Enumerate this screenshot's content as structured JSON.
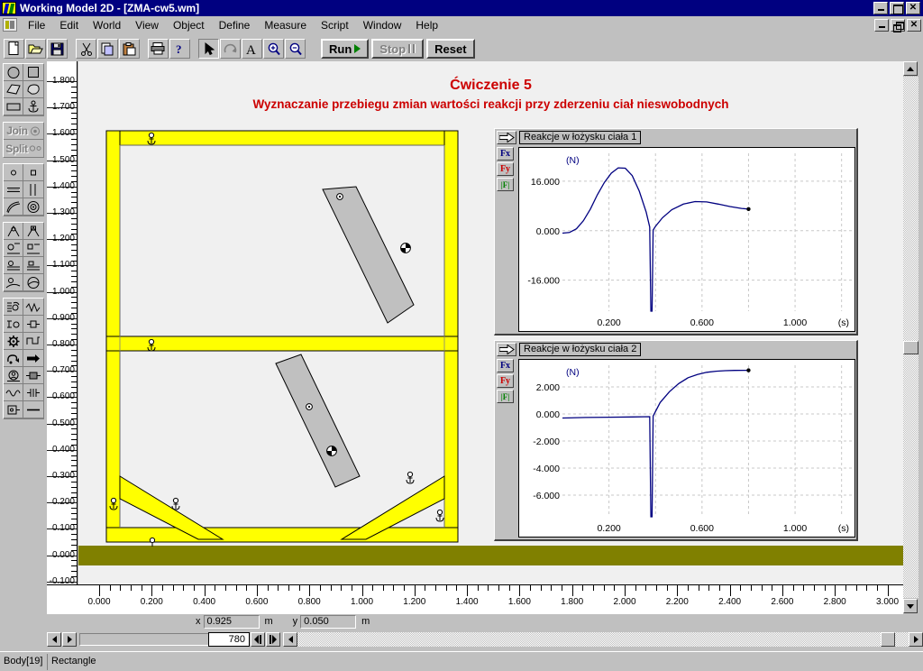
{
  "window": {
    "title": "Working Model 2D - [ZMA-cw5.wm]",
    "app_icon": "app-icon",
    "buttons": {
      "minimize": "_",
      "maximize": "□",
      "close": "✕",
      "restore": "❐"
    }
  },
  "menu": {
    "items": [
      {
        "label": "File"
      },
      {
        "label": "Edit"
      },
      {
        "label": "World"
      },
      {
        "label": "View"
      },
      {
        "label": "Object"
      },
      {
        "label": "Define"
      },
      {
        "label": "Measure"
      },
      {
        "label": "Script"
      },
      {
        "label": "Window"
      },
      {
        "label": "Help"
      }
    ]
  },
  "toolbar": {
    "file_tools": [
      "new-icon",
      "open-icon",
      "save-icon"
    ],
    "edit_tools": [
      "cut-icon",
      "copy-icon",
      "paste-icon"
    ],
    "print_tools": [
      "print-icon",
      "help-icon"
    ],
    "mode_tools": [
      "arrow-icon",
      "rotate-icon",
      "text-icon",
      "zoom-in-icon",
      "zoom-out-icon"
    ],
    "run_label": "Run",
    "stop_label": "Stop",
    "reset_label": "Reset"
  },
  "palette": {
    "groups": [
      {
        "name": "shape-tools",
        "cells": [
          "circle-body-icon",
          "square-body-icon",
          "polygon-body-icon",
          "curved-polygon-icon",
          "rectangle-body-icon",
          "anchor-icon"
        ]
      },
      {
        "name": "join-split",
        "join_label": "Join",
        "split_label": "Split"
      },
      {
        "name": "point-tools",
        "cells": [
          "point-element-icon",
          "square-point-icon",
          "slot-horizontal-icon",
          "slot-vertical-icon",
          "curved-slot-icon",
          "pinned-circle-icon"
        ]
      },
      {
        "name": "constraint-tools",
        "cells": [
          "pin-joint-icon",
          "rigid-joint-icon",
          "slot-joint-icon",
          "keyed-slot-icon",
          "pin-slot-icon",
          "rigid-slot-icon",
          "curved-pin-icon",
          "curved-slot-joint-icon"
        ]
      },
      {
        "name": "force-tools",
        "cells": [
          "spring-icon",
          "damper-icon",
          "spring-damper-icon",
          "rod-icon",
          "gear-icon",
          "separator-icon",
          "rope-icon",
          "force-arrow-icon",
          "actuator-icon",
          "motor-icon",
          "rotational-spring-icon",
          "rotational-damper-icon",
          "torque-icon",
          "rod-link-icon"
        ]
      }
    ]
  },
  "canvas": {
    "title_line1": "Ćwiczenie 5",
    "title_line2": "Wyznaczanie przebiegu zmian wartości reakcji przy zderzeniu ciał nieswobodnych",
    "colors": {
      "frame": "#ffff00",
      "body": "#c0c0c0",
      "ground": "#808000",
      "background": "#f0f0f0",
      "title": "#cc0000"
    }
  },
  "vertical_ruler": {
    "unit": "m",
    "labels": [
      "1.800",
      "1.700",
      "1.600",
      "1.500",
      "1.400",
      "1.300",
      "1.200",
      "1.100",
      "1.000",
      "0.900",
      "0.800",
      "0.700",
      "0.600",
      "0.500",
      "0.400",
      "0.300",
      "0.200",
      "0.100",
      "0.000",
      "-0.100"
    ]
  },
  "horizontal_ruler": {
    "unit": "m",
    "labels": [
      "0.000",
      "0.200",
      "0.400",
      "0.600",
      "0.800",
      "1.000",
      "1.200",
      "1.400",
      "1.600",
      "1.800",
      "2.000",
      "2.200",
      "2.400",
      "2.600",
      "2.800",
      "3.000"
    ]
  },
  "graphs": [
    {
      "title": "Reakcje w łożysku ciała 1",
      "buttons": [
        {
          "label": "Fx",
          "color": "#000080"
        },
        {
          "label": "Fy",
          "color": "#cc0000"
        },
        {
          "label": "|F|",
          "color": "#008000"
        }
      ],
      "y_unit": "(N)",
      "x_unit": "(s)",
      "y_ticklabels": [
        "16.000",
        "0.000",
        "-16.000"
      ],
      "x_ticklabels": [
        "0.200",
        "0.600",
        "1.000"
      ]
    },
    {
      "title": "Reakcje w łożysku ciała 2",
      "buttons": [
        {
          "label": "Fx",
          "color": "#000080"
        },
        {
          "label": "Fy",
          "color": "#cc0000"
        },
        {
          "label": "|F|",
          "color": "#008000"
        }
      ],
      "y_unit": "(N)",
      "x_unit": "(s)",
      "y_ticklabels": [
        "2.000",
        "0.000",
        "-2.000",
        "-4.000",
        "-6.000"
      ],
      "x_ticklabels": [
        "0.200",
        "0.600",
        "1.000"
      ]
    }
  ],
  "chart_data": [
    {
      "type": "line",
      "title": "Reakcje w łożysku ciała 1",
      "xlabel": "(s)",
      "ylabel": "(N)",
      "xlim": [
        0.0,
        1.24
      ],
      "ylim": [
        -26.0,
        25.0
      ],
      "yticks": [
        16.0,
        0.0,
        -16.0
      ],
      "xticks": [
        0.2,
        0.6,
        1.0
      ],
      "grid": true,
      "legend": [
        "Fx",
        "Fy",
        "|F|"
      ],
      "series": [
        {
          "name": "Fx",
          "color": "#000080",
          "x": [
            0.0,
            0.03,
            0.06,
            0.09,
            0.12,
            0.15,
            0.18,
            0.21,
            0.24,
            0.27,
            0.3,
            0.33,
            0.36,
            0.375,
            0.38,
            0.385,
            0.39,
            0.4,
            0.43,
            0.47,
            0.52,
            0.57,
            0.62,
            0.67,
            0.72,
            0.77,
            0.8
          ],
          "values": [
            -0.8,
            -0.6,
            0.6,
            3.2,
            7.0,
            11.6,
            15.6,
            18.6,
            20.3,
            20.2,
            17.8,
            12.8,
            6.0,
            1.2,
            -26.0,
            -26.0,
            0.2,
            1.4,
            4.2,
            6.8,
            8.6,
            9.4,
            9.3,
            8.6,
            7.8,
            7.2,
            7.0
          ]
        }
      ],
      "endpoint_marker": {
        "x": 0.8,
        "y": 7.0
      }
    },
    {
      "type": "line",
      "title": "Reakcje w łożysku ciała 2",
      "xlabel": "(s)",
      "ylabel": "(N)",
      "xlim": [
        0.0,
        1.24
      ],
      "ylim": [
        -7.6,
        3.6
      ],
      "yticks": [
        2.0,
        0.0,
        -2.0,
        -4.0,
        -6.0
      ],
      "xticks": [
        0.2,
        0.6,
        1.0
      ],
      "grid": true,
      "legend": [
        "Fx",
        "Fy",
        "|F|"
      ],
      "series": [
        {
          "name": "Fx",
          "color": "#000080",
          "x": [
            0.0,
            0.1,
            0.2,
            0.3,
            0.375,
            0.38,
            0.385,
            0.39,
            0.42,
            0.46,
            0.5,
            0.54,
            0.58,
            0.62,
            0.66,
            0.7,
            0.74,
            0.78,
            0.8
          ],
          "values": [
            -0.3,
            -0.26,
            -0.24,
            -0.22,
            -0.2,
            -7.6,
            -7.6,
            -0.15,
            0.85,
            1.65,
            2.25,
            2.68,
            2.92,
            3.08,
            3.16,
            3.2,
            3.22,
            3.23,
            3.23
          ]
        }
      ],
      "endpoint_marker": {
        "x": 0.8,
        "y": 3.23
      }
    }
  ],
  "coordinate_bar": {
    "x_label": "x",
    "x_value": "0.925",
    "x_unit": "m",
    "y_label": "y",
    "y_value": "0.050",
    "y_unit": "m"
  },
  "frame_control": {
    "frame_value": "780"
  },
  "status_bar": {
    "object_id": "Body[19]",
    "object_type": "Rectangle"
  }
}
